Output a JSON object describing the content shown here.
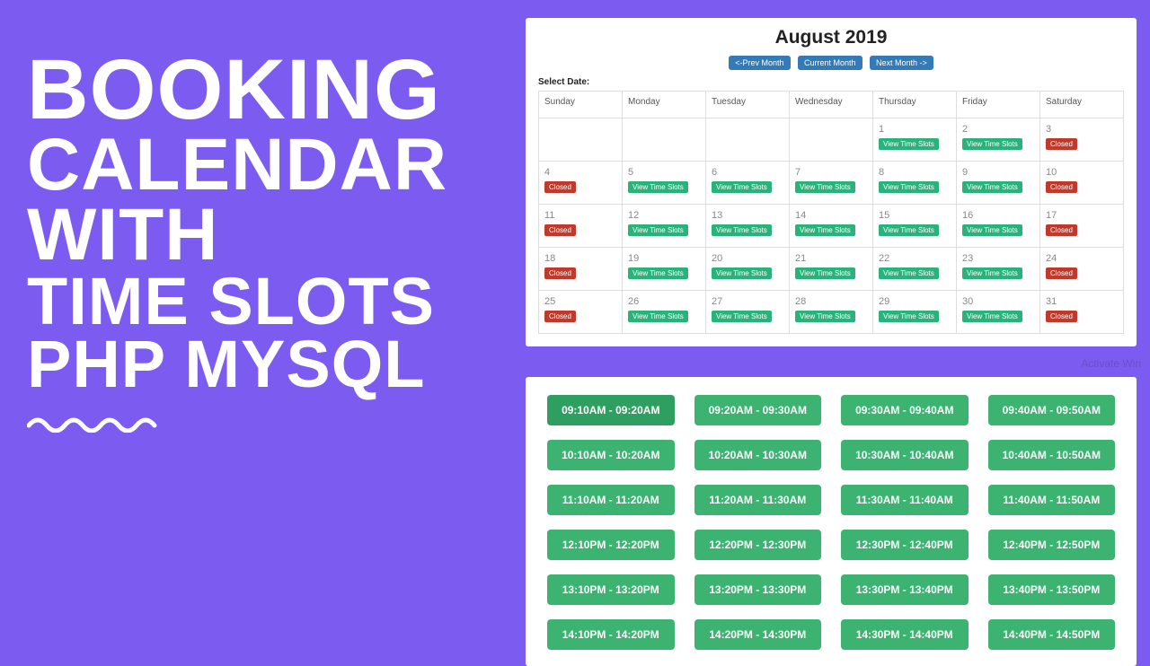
{
  "hero": {
    "line1": "BOOKING",
    "line2": "CALENDAR",
    "line3": "WITH",
    "line4": "TIME SLOTS",
    "line5": "PHP MYSQL"
  },
  "php_logo": "PHP",
  "watermark": "Activate Win",
  "calendar": {
    "title": "August 2019",
    "nav": {
      "prev": "<-Prev Month",
      "current": "Current Month",
      "next": "Next Month ->"
    },
    "select_label": "Select Date:",
    "days": [
      "Sunday",
      "Monday",
      "Tuesday",
      "Wednesday",
      "Thursday",
      "Friday",
      "Saturday"
    ],
    "open_label": "View Time Slots",
    "closed_label": "Closed",
    "weeks": [
      [
        null,
        null,
        null,
        null,
        {
          "d": "1",
          "s": "open"
        },
        {
          "d": "2",
          "s": "open"
        },
        {
          "d": "3",
          "s": "closed"
        }
      ],
      [
        {
          "d": "4",
          "s": "closed"
        },
        {
          "d": "5",
          "s": "open"
        },
        {
          "d": "6",
          "s": "open"
        },
        {
          "d": "7",
          "s": "open"
        },
        {
          "d": "8",
          "s": "open"
        },
        {
          "d": "9",
          "s": "open"
        },
        {
          "d": "10",
          "s": "closed"
        }
      ],
      [
        {
          "d": "11",
          "s": "closed"
        },
        {
          "d": "12",
          "s": "open"
        },
        {
          "d": "13",
          "s": "open"
        },
        {
          "d": "14",
          "s": "open"
        },
        {
          "d": "15",
          "s": "open"
        },
        {
          "d": "16",
          "s": "open"
        },
        {
          "d": "17",
          "s": "closed"
        }
      ],
      [
        {
          "d": "18",
          "s": "closed"
        },
        {
          "d": "19",
          "s": "open"
        },
        {
          "d": "20",
          "s": "open"
        },
        {
          "d": "21",
          "s": "open"
        },
        {
          "d": "22",
          "s": "open"
        },
        {
          "d": "23",
          "s": "open"
        },
        {
          "d": "24",
          "s": "closed"
        }
      ],
      [
        {
          "d": "25",
          "s": "closed"
        },
        {
          "d": "26",
          "s": "open"
        },
        {
          "d": "27",
          "s": "open"
        },
        {
          "d": "28",
          "s": "open"
        },
        {
          "d": "29",
          "s": "open"
        },
        {
          "d": "30",
          "s": "open"
        },
        {
          "d": "31",
          "s": "closed"
        }
      ]
    ]
  },
  "slots": [
    [
      "09:10AM - 09:20AM",
      "09:20AM - 09:30AM",
      "09:30AM - 09:40AM",
      "09:40AM - 09:50AM"
    ],
    [
      "10:10AM - 10:20AM",
      "10:20AM - 10:30AM",
      "10:30AM - 10:40AM",
      "10:40AM - 10:50AM"
    ],
    [
      "11:10AM - 11:20AM",
      "11:20AM - 11:30AM",
      "11:30AM - 11:40AM",
      "11:40AM - 11:50AM"
    ],
    [
      "12:10PM - 12:20PM",
      "12:20PM - 12:30PM",
      "12:30PM - 12:40PM",
      "12:40PM - 12:50PM"
    ],
    [
      "13:10PM - 13:20PM",
      "13:20PM - 13:30PM",
      "13:30PM - 13:40PM",
      "13:40PM - 13:50PM"
    ],
    [
      "14:10PM - 14:20PM",
      "14:20PM - 14:30PM",
      "14:30PM - 14:40PM",
      "14:40PM - 14:50PM"
    ]
  ]
}
